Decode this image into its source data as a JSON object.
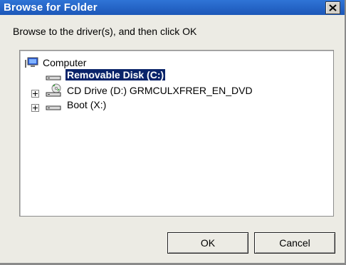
{
  "dialog": {
    "title": "Browse for Folder",
    "prompt": "Browse to the driver(s), and then click OK"
  },
  "tree": {
    "root": {
      "label": "Computer",
      "icon": "computer-icon"
    },
    "items": [
      {
        "label": "Removable Disk (C:)",
        "icon": "removable-disk-icon",
        "selected": true
      },
      {
        "label": "CD Drive (D:) GRMCULXFRER_EN_DVD",
        "icon": "cd-drive-icon",
        "expandable": true
      },
      {
        "label": "Boot (X:)",
        "icon": "drive-icon",
        "expandable": true
      }
    ]
  },
  "buttons": {
    "ok": "OK",
    "cancel": "Cancel"
  },
  "colors": {
    "titlebar": "#1c57b8",
    "selection": "#0a246a",
    "dialog_bg": "#ecebe4"
  }
}
